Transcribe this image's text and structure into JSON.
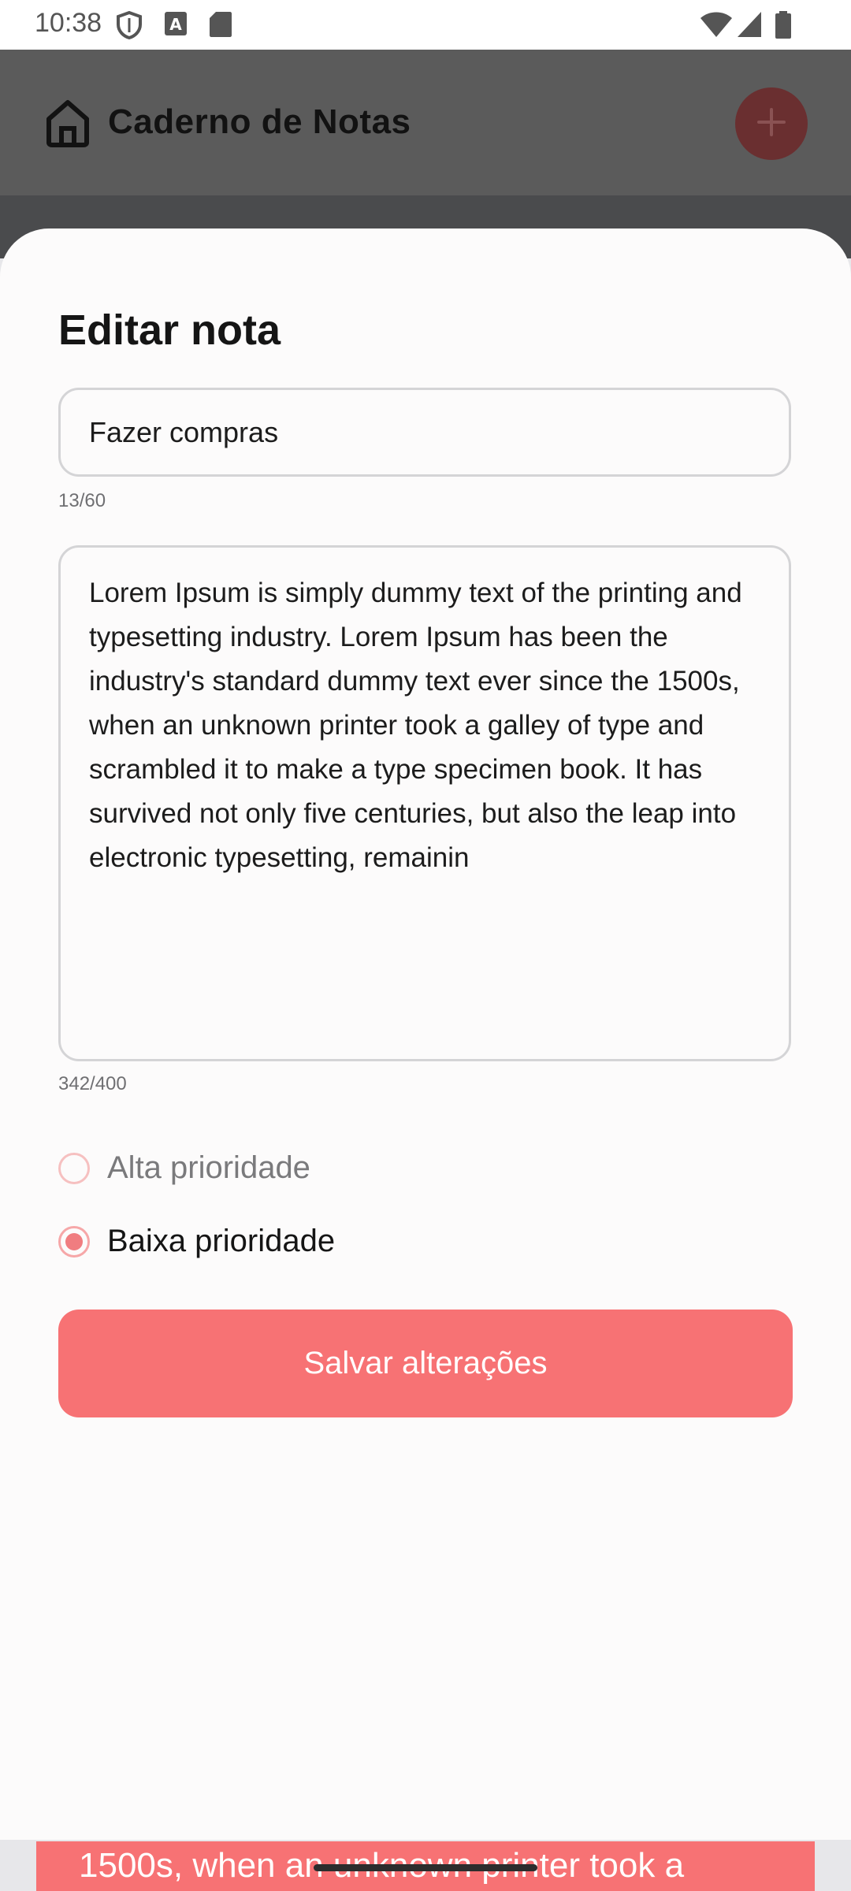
{
  "status_bar": {
    "time": "10:38",
    "icons": [
      "shield-icon",
      "a-badge-icon",
      "sd-card-icon",
      "wifi-icon",
      "signal-icon",
      "battery-icon"
    ]
  },
  "app_bar": {
    "title": "Caderno de Notas",
    "icons": [
      "home-icon",
      "plus-icon"
    ]
  },
  "sheet": {
    "title": "Editar nota",
    "title_field": {
      "value": "Fazer compras",
      "counter": "13/60"
    },
    "body_field": {
      "value": "Lorem Ipsum is simply dummy text of the printing and typesetting industry. Lorem Ipsum has been the industry's standard dummy text ever since the 1500s, when an unknown printer took a galley of type and scrambled it to make a type specimen book. It has survived not only five centuries, but also the leap into electronic typesetting, remainin",
      "counter": "342/400"
    },
    "priority_options": [
      {
        "label": "Alta prioridade",
        "checked": false
      },
      {
        "label": "Baixa prioridade",
        "checked": true
      }
    ],
    "save_label": "Salvar alterações"
  },
  "background_note": {
    "text": "1500s, when an unknown printer took a"
  },
  "colors": {
    "accent": "#f77274",
    "fab_dimmed": "#6a2f30",
    "scrim": "#5b5b5b"
  }
}
